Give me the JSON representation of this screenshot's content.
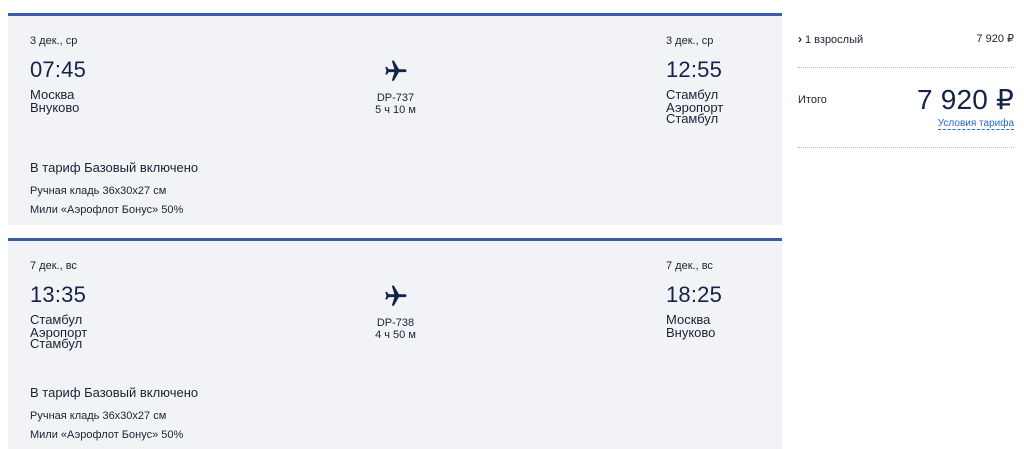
{
  "segments": [
    {
      "dep_date": "3 дек., ср",
      "dep_time": "07:45",
      "dep_city": "Москва",
      "dep_airport_lines": [
        "Внуково"
      ],
      "flight": "DP-737",
      "duration": "5 ч 10 м",
      "arr_date": "3 дек., ср",
      "arr_time": "12:55",
      "arr_city": "Стамбул",
      "arr_airport_lines": [
        "Аэропорт",
        "Стамбул"
      ],
      "tariff": "В тариф Базовый включено",
      "included": [
        "Ручная кладь 36x30x27 см",
        "Мили «Аэрофлот Бонус» 50%"
      ]
    },
    {
      "dep_date": "7 дек., вс",
      "dep_time": "13:35",
      "dep_city": "Стамбул",
      "dep_airport_lines": [
        "Аэропорт",
        "Стамбул"
      ],
      "flight": "DP-738",
      "duration": "4 ч 50 м",
      "arr_date": "7 дек., вс",
      "arr_time": "18:25",
      "arr_city": "Москва",
      "arr_airport_lines": [
        "Внуково"
      ],
      "tariff": "В тариф Базовый включено",
      "included": [
        "Ручная кладь 36x30x27 см",
        "Мили «Аэрофлот Бонус» 50%"
      ]
    }
  ],
  "summary": {
    "passengers_label": "1 взрослый",
    "passengers_price": "7 920 ₽",
    "total_label": "Итого",
    "total_price": "7 920 ₽",
    "fare_conditions_link": "Условия тарифа"
  },
  "icons": {
    "plane": "airplane-icon",
    "expand": "chevron-right-icon"
  },
  "colors": {
    "accent_border": "#3a5ba8",
    "card_bg": "#f1f3f7",
    "text_dark": "#13234a",
    "link": "#2a66c9"
  }
}
